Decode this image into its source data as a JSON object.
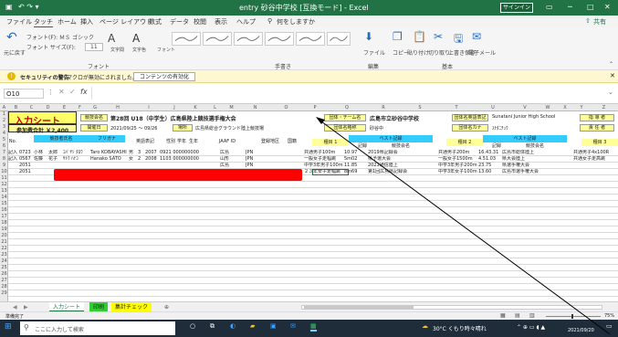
{
  "titlebar": {
    "quick_access": "↶ ↷ ▾",
    "doc_title": "entry 砂谷中学校 [互換モード] - Excel",
    "signin": "サインイン"
  },
  "menu": {
    "items": [
      "ファイル",
      "タッチ",
      "ホーム",
      "挿入",
      "ページ レイアウト",
      "数式",
      "データ",
      "校閲",
      "表示",
      "ヘルプ"
    ],
    "tell_me": "何をしますか",
    "share": "共有"
  },
  "ribbon": {
    "undo": "元に戻す",
    "font_name": "フォント(F): ＭＳ ゴシック",
    "font_size": "フォント サイズ(F):",
    "font_size_val": "11",
    "font_grow": "A",
    "font_shrink": "A",
    "font_group": "フォント",
    "handwriting_group": "手書き",
    "edit_group": "編集",
    "basic_group": "基本",
    "file_label": "ファイル",
    "copy": "コピー",
    "paste": "貼り付け",
    "cut": "切り取り",
    "overwrite_save": "上書き保存",
    "email": "電子メール",
    "text_style": "文字間",
    "text_color": "文字色",
    "font_bold": "フォント"
  },
  "security": {
    "title": "セキュリティの警告",
    "message": "マクロが無効にされました。",
    "button": "コンテンツの有効化"
  },
  "formula": {
    "name_box": "O10",
    "fx": "fx",
    "value": ""
  },
  "columns": [
    "A",
    "B",
    "C",
    "D",
    "E",
    "F",
    "G",
    "H",
    "I",
    "J",
    "K",
    "L",
    "M",
    "N",
    "O",
    "P",
    "Q",
    "R",
    "S",
    "T",
    "U",
    "V",
    "W",
    "X",
    "Y",
    "Z"
  ],
  "rows": [
    "1",
    "2",
    "3",
    "4",
    "5",
    "6",
    "7",
    "8",
    "9",
    "10",
    "11",
    "12",
    "13",
    "14",
    "15",
    "16",
    "17",
    "18",
    "19",
    "20",
    "21",
    "22",
    "23",
    "24",
    "25",
    "26",
    "27",
    "28",
    "29"
  ],
  "sheet": {
    "entry_title": "入力シート",
    "fee_label": "参加費合計 ￥2,400",
    "school_no_label": "競技会名",
    "meet_name": "第28回 U18（中学生）広島県陸上競技選手権大会",
    "date_label": "開催日",
    "date": "2021/09/25 ～ 09/26",
    "venue_label": "場所",
    "venue": "広島県総合グラウンド陸上競技場",
    "team_label": "団体・チーム名",
    "team": "広島市立砂谷中学校",
    "abbr_label": "団体名略称",
    "abbr": "砂谷中",
    "en_label": "団体名英語表記",
    "en": "Sunatani Junior High School",
    "kana_label": "団体名カナ",
    "kana": "ｽﾅﾀﾆﾁｭｳ",
    "coach_label": "指 導 者",
    "rep_label": "責 任 者",
    "hdr_no": "No.",
    "hdr_name": "競技者氏名",
    "hdr_kana": "フリガナ",
    "hdr_en": "英語表記",
    "hdr_sex": "性別",
    "hdr_grade": "学年",
    "hdr_birth": "生年",
    "hdr_jaaf": "JAAF ID",
    "hdr_area": "登録地区",
    "hdr_nat": "国籍",
    "ev1": "種目 1",
    "ev2": "種目 2",
    "ev3": "種目 3",
    "best": "ベスト記録",
    "rec": "記録",
    "rec_meet": "競技会名",
    "athletes": [
      {
        "flag": "記入済",
        "no": "0723",
        "name1": "小林",
        "name2": "太郎",
        "kana": "ｺﾊﾞﾔｼ ﾀﾛｳ",
        "en": "Taro KOBAYASHI",
        "sex": "男",
        "grade": "3",
        "birth": "2007",
        "id": "0921 000000000",
        "area": "広島",
        "nat": "JPN",
        "e1": "共通男子100m",
        "r1": "10.97",
        "m1": "2019県記録会",
        "e2": "共通男子200m",
        "r2": "16.43.31",
        "m2": "広島市総体陸上",
        "e3": "",
        "r3": "",
        "m3": "共通男子4x100R"
      },
      {
        "flag": "記入済",
        "no": "0567",
        "name1": "佐藤",
        "name2": "花子",
        "kana": "ｻﾄｳ ﾊﾅｺ",
        "en": "Hanako SATO",
        "sex": "女",
        "grade": "2",
        "birth": "2008",
        "id": "1103 000000000",
        "area": "山形",
        "nat": "JPN",
        "e1": "一般女子走幅跳",
        "r1": "5m02",
        "m1": "県予選大会",
        "e2": "一般女子1500m",
        "r2": "4.51.03",
        "m2": "県大会陸上",
        "e3": "",
        "r3": "",
        "m3": "共通女子走高跳"
      },
      {
        "flag": "",
        "no": "2051",
        "name1": "",
        "name2": "",
        "kana": "",
        "en": "",
        "sex": "",
        "grade": "",
        "birth": "",
        "id": "",
        "area": "広島",
        "nat": "JPN",
        "e1": "中学3年男子100m",
        "r1": "11.85",
        "m1": "2021通信陸上",
        "e2": "中学3年男子200m",
        "r2": "23.75",
        "m2": "県選手権大会",
        "e3": "",
        "r3": "",
        "m3": ""
      },
      {
        "flag": "",
        "no": "2051",
        "name1": "",
        "name2": "",
        "kana": "",
        "en": "",
        "sex": "",
        "grade": "",
        "birth": "",
        "id": "",
        "area": "広島",
        "nat": "JPN",
        "e1": "２３年女子走幅跳",
        "r1": "8m69",
        "m1": "第1回広島県記録会",
        "e2": "中学3年女子100m",
        "r2": "13.60",
        "m2": "広島市選手権大会",
        "e3": "",
        "r3": "",
        "m3": ""
      }
    ]
  },
  "tabs": [
    "入力シート",
    "印刷",
    "集計チェック",
    "⊕"
  ],
  "status": {
    "ready": "準備完了",
    "zoom": "75%"
  },
  "taskbar": {
    "search_placeholder": "ここに入力して検索",
    "weather": "30°C くもり時々晴れ",
    "time": "",
    "date": "2021/09/20"
  }
}
